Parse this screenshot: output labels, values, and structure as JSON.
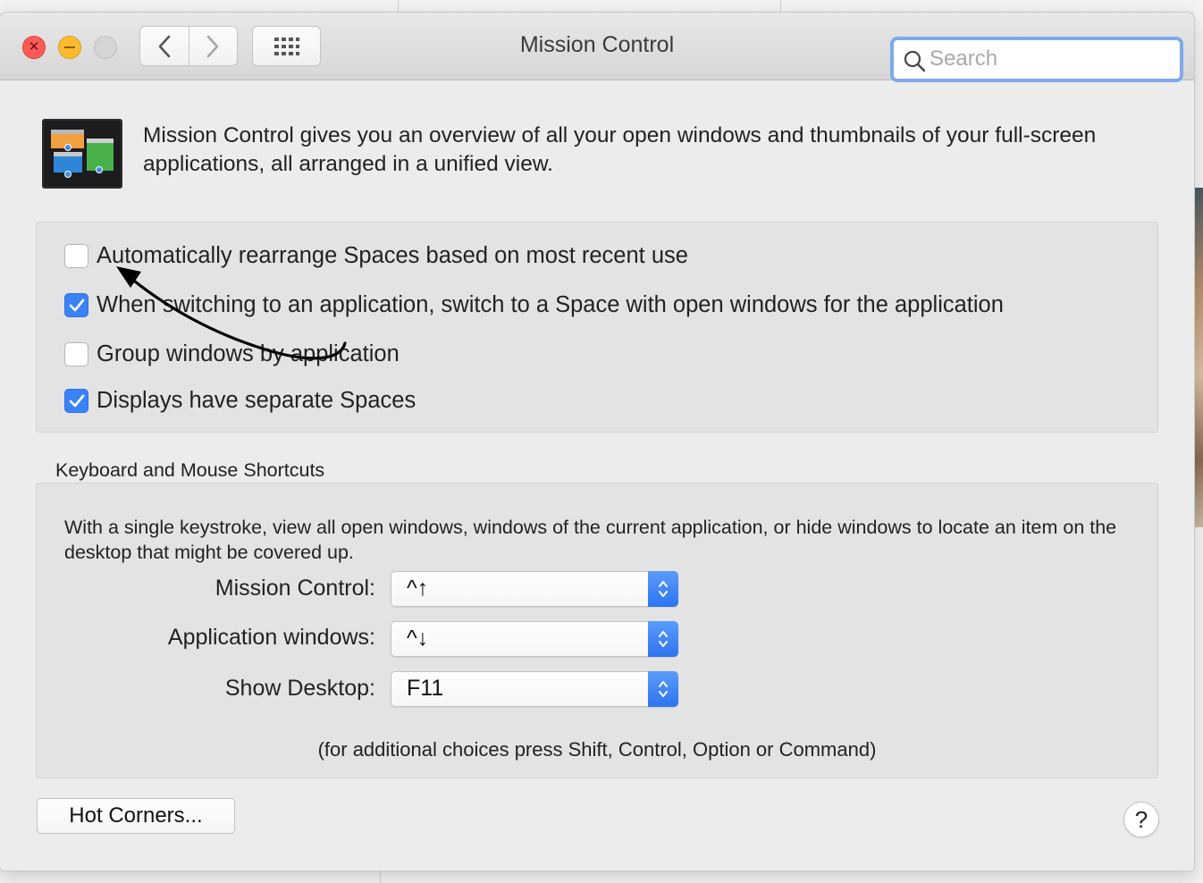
{
  "window": {
    "title": "Mission Control"
  },
  "toolbar": {
    "back_icon": "chevron-left-icon",
    "forward_icon": "chevron-right-icon",
    "show_all_icon": "grid-icon"
  },
  "search": {
    "placeholder": "Search",
    "value": ""
  },
  "header": {
    "description": "Mission Control gives you an overview of all your open windows and thumbnails of your full-screen applications, all arranged in a unified view."
  },
  "options": [
    {
      "label": "Automatically rearrange Spaces based on most recent use",
      "checked": false
    },
    {
      "label": "When switching to an application, switch to a Space with open windows for the application",
      "checked": true
    },
    {
      "label": "Group windows by application",
      "checked": false
    },
    {
      "label": "Displays have separate Spaces",
      "checked": true
    }
  ],
  "shortcuts": {
    "heading": "Keyboard and Mouse Shortcuts",
    "description": "With a single keystroke, view all open windows, windows of the current application, or hide windows to locate an item on the desktop that might be covered up.",
    "rows": [
      {
        "label": "Mission Control:",
        "value": "^↑"
      },
      {
        "label": "Application windows:",
        "value": "^↓"
      },
      {
        "label": "Show Desktop:",
        "value": "F11"
      }
    ],
    "note": "(for additional choices press Shift, Control, Option or Command)"
  },
  "footer": {
    "hot_corners_label": "Hot Corners...",
    "help_label": "?"
  },
  "colors": {
    "accent": "#3b82f7",
    "close": "#fc5b57",
    "minimize": "#fdbb2e",
    "search_focus_ring": "#7ea9ea"
  }
}
